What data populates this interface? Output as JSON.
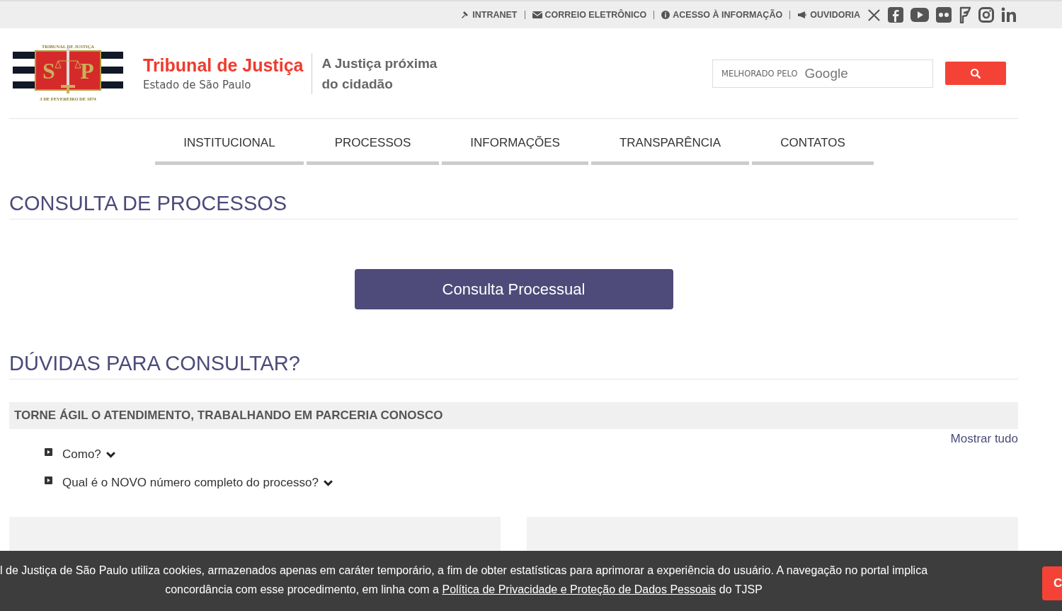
{
  "top_bar": {
    "links": [
      {
        "kind": "gavel",
        "label": "INTRANET"
      },
      {
        "kind": "mail",
        "label": "CORREIO ELETRÔNICO"
      },
      {
        "kind": "info",
        "label": "ACESSO À INFORMAÇÃO"
      },
      {
        "kind": "megaphone",
        "label": "OUVIDORIA"
      }
    ],
    "social": [
      {
        "kind": "x"
      },
      {
        "kind": "facebook"
      },
      {
        "kind": "youtube"
      },
      {
        "kind": "flickr"
      },
      {
        "kind": "flag"
      },
      {
        "kind": "instagram"
      },
      {
        "kind": "linkedin"
      }
    ]
  },
  "header": {
    "logo": {
      "top_text": "TRIBUNAL DE JUSTIÇA",
      "left_letter": "S",
      "right_letter": "P",
      "bottom_text": "3 DE FEVEREIRO DE 1874"
    },
    "title": "Tribunal de Justiça",
    "subtitle": "Estado de São Paulo",
    "slogan_lines": [
      "A Justiça próxima",
      "do cidadão"
    ],
    "search": {
      "placeholder_prefix": "MELHORADO PELO",
      "placeholder_brand": "Google"
    }
  },
  "nav": [
    "INSTITUCIONAL",
    "PROCESSOS",
    "INFORMAÇÕES",
    "TRANSPARÊNCIA",
    "CONTATOS"
  ],
  "section_title": "CONSULTA DE PROCESSOS",
  "primary_button": "Consulta Processual",
  "help_title": "DÚVIDAS PARA CONSULTAR?",
  "panel": {
    "title": "TORNE ÁGIL O ATENDIMENTO, TRABALHANDO EM PARCERIA CONOSCO",
    "show_all": "Mostrar tudo",
    "items": [
      {
        "label": "Como?",
        "expanded": false
      },
      {
        "label": "Qual é o NOVO número completo do processo?",
        "expanded": false
      }
    ]
  },
  "cookie_banner": {
    "line_1": "l de Justiça de São Paulo utiliza cookies, armazenados apenas em caráter temporário, a fim de obter estatísticas para aprimorar a experiência do usuário. A navegação no portal implica",
    "text_before": "concordância com esse procedimento, em linha com a",
    "link": "Política de Privacidade e Proteção de Dados Pessoais",
    "text_after": "do TJSP",
    "button": "C"
  }
}
